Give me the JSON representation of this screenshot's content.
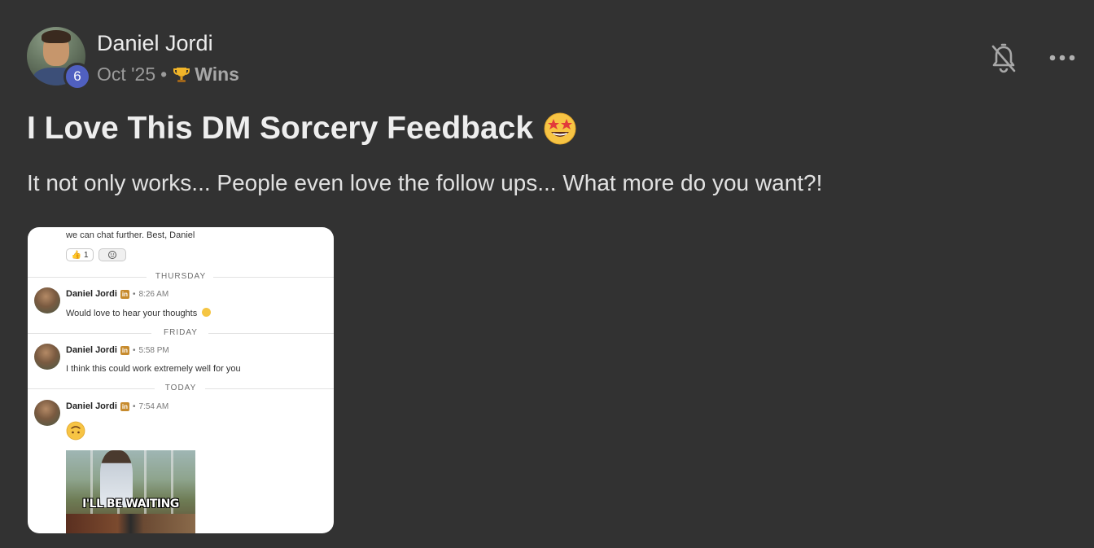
{
  "author": {
    "name": "Daniel Jordi",
    "level": "6"
  },
  "meta": {
    "date": "Oct '25",
    "separator": "•",
    "category": "Wins",
    "category_icon": "trophy-icon"
  },
  "actions": {
    "notifications_icon": "bell-off-icon",
    "more_icon": "more-horizontal-icon"
  },
  "post": {
    "title": "I Love This DM Sorcery Feedback",
    "title_emoji": "star-struck-emoji",
    "body": "It not only works... People even love the follow ups... What more do you want?!"
  },
  "attachment": {
    "top_text": "we can chat further. Best, Daniel",
    "reaction_count": "1",
    "reaction_emoji": "thumbs-up",
    "messages": [
      {
        "day": "THURSDAY",
        "sender": "Daniel Jordi",
        "time": "8:26 AM",
        "text": "Would love to hear your thoughts",
        "trailing_emoji": "slightly-smiling-face"
      },
      {
        "day": "FRIDAY",
        "sender": "Daniel Jordi",
        "time": "5:58 PM",
        "text": "I think this could work extremely well for you"
      },
      {
        "day": "TODAY",
        "sender": "Daniel Jordi",
        "time": "7:54 AM",
        "emoji": "upside-down-face",
        "gif_caption": "I'LL BE WAITING"
      }
    ],
    "linkedin_badge": "in"
  },
  "colors": {
    "background": "#323232",
    "level_badge": "#5060c0",
    "text_primary": "#eeeeee",
    "text_muted": "#9b9b9b"
  }
}
